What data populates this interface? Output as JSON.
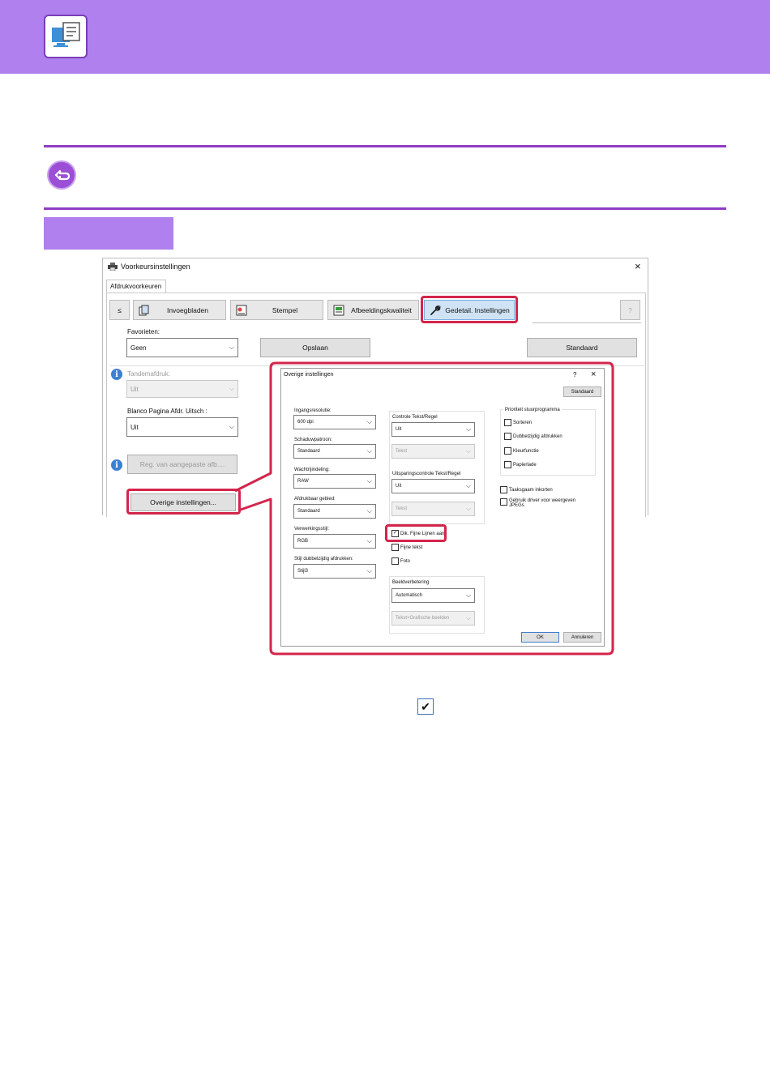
{
  "main_dialog": {
    "title": "Voorkeursinstellingen",
    "close": "×",
    "tab": "Afdrukvoorkeuren",
    "toolbar": {
      "prev": "≤",
      "invoegbladen": "Invoegbladen",
      "stempel": "Stempel",
      "afbeeldingskwaliteit": "Afbeeldingskwaliteit",
      "gedetail": "Gedetail. Instellingen",
      "help": "?"
    },
    "favorieten_label": "Favorieten:",
    "favorieten_value": "Geen",
    "opslaan": "Opslaan",
    "standaard": "Standaard",
    "tandemafdruk_label": "Tandemafdruk:",
    "tandemafdruk_value": "Uit",
    "blanco_label": "Blanco Pagina Afdr. Uitsch :",
    "blanco_value": "Uit",
    "reg_button": "Reg. van aangepaste afb....",
    "overige_button": "Overige instellingen..."
  },
  "sub_dialog": {
    "title": "Overige instellingen",
    "help": "?",
    "close": "×",
    "standaard": "Standaard",
    "ingangsresolutie_label": "Ingangsresolutie:",
    "ingangsresolutie_value": "600 dpi",
    "schaduwpatroon_label": "Schaduwpatroon:",
    "schaduwpatroon_value": "Standaard",
    "wachtrijindeling_label": "Wachtrijindeling:",
    "wachtrijindeling_value": "RAW",
    "afdrukbaar_label": "Afdrukbaar gebied:",
    "afdrukbaar_value": "Standaard",
    "verwerkingsstijl_label": "Verwerkingsstijl:",
    "verwerkingsstijl_value": "RGB",
    "stijl_label": "Stijl dubbelzijdig afdrukken:",
    "stijl_value": "Stijl3",
    "controle_label": "Controle Tekst/Regel",
    "controle_value": "Uit",
    "controle_tekst": "Tekst",
    "uitsparing_label": "Uitsparingscontrole Tekst/Regel",
    "uitsparing_value": "Uit",
    "uitsparing_tekst": "Tekst",
    "cb_fijne_lijnen": "Dik. Fijne Lijnen aan",
    "cb_fijne_tekst": "Fijne tekst",
    "cb_foto": "Foto",
    "beeldverbetering_label": "Beeldverbetering",
    "beeldverbetering_value": "Automatisch",
    "beeldverbetering_second": "Tekst+Grafische beelden",
    "prioriteit_label": "Prioriteit stuurprogramma",
    "cb_sorteren": "Sorteren",
    "cb_dubbelzijdig": "Dubbelzijdig afdrukken",
    "cb_kleurfunctie": "Kleurfunctie",
    "cb_papierlade": "Papierlade",
    "cb_taaksgaam": "Taaksgaam inkorten",
    "cb_gebruik": "Gebruik driver voor weergeven JPEGs",
    "ok": "OK",
    "annuleren": "Annuleren"
  },
  "checkmark": "✔",
  "colors": {
    "header": "#b080ee",
    "accent_line": "#8e3dc4",
    "highlight": "#d3254b"
  }
}
